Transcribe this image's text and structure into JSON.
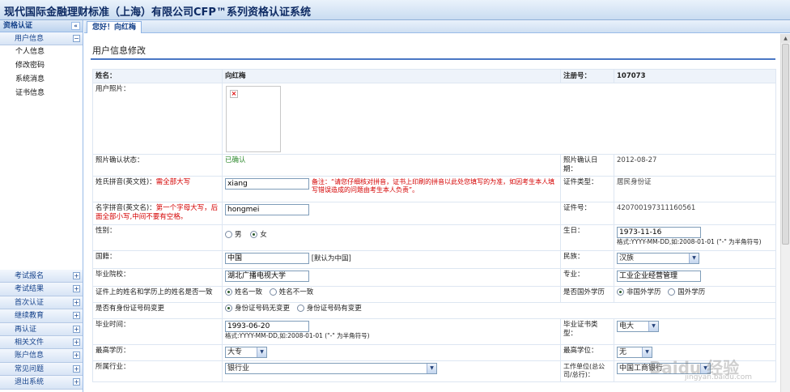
{
  "app": {
    "title": "现代国际金融理财标准（上海）有限公司CFP™系列资格认证系统"
  },
  "sidebar": {
    "title": "资格认证",
    "collapse_icon": "«",
    "expanded_group": {
      "label": "用户信息",
      "toggle": "−",
      "items": [
        {
          "label": "个人信息"
        },
        {
          "label": "修改密码"
        },
        {
          "label": "系统消息"
        },
        {
          "label": "证书信息"
        }
      ]
    },
    "groups": [
      {
        "label": "考试报名",
        "toggle": "+"
      },
      {
        "label": "考试结果",
        "toggle": "+"
      },
      {
        "label": "首次认证",
        "toggle": "+"
      },
      {
        "label": "继续教育",
        "toggle": "+"
      },
      {
        "label": "再认证",
        "toggle": "+"
      },
      {
        "label": "相关文件",
        "toggle": "+"
      },
      {
        "label": "账户信息",
        "toggle": "+"
      },
      {
        "label": "常见问题",
        "toggle": "+"
      },
      {
        "label": "退出系统",
        "toggle": "+"
      }
    ]
  },
  "tab": {
    "label": "您好！向红梅"
  },
  "page": {
    "title": "用户信息修改"
  },
  "form": {
    "name_label": "姓名：",
    "name_value": "向红梅",
    "reg_label": "注册号：",
    "reg_value": "107073",
    "photo_label": "用户照片：",
    "photo_status_label": "照片确认状态：",
    "photo_status_value": "已确认",
    "photo_date_label": "照片确认日期：",
    "photo_date_value": "2012-08-27",
    "surname_label": "姓氏拼音(英文姓)：",
    "surname_hint": "需全部大写",
    "surname_value": "xiang",
    "note_text": "备注：“请您仔细核对拼音，证书上印刷的拼音以此处您填写的为准，如因考生本人填写错误造成的问题由考生本人负责”。",
    "id_type_label": "证件类型：",
    "id_type_value": "居民身份证",
    "given_label": "名字拼音(英文名)：",
    "given_hint": "第一个字母大写，后面全部小写,中间不要有空格。",
    "given_value": "hongmei",
    "id_no_label": "证件号：",
    "id_no_value": "420700197311160561",
    "gender_label": "性别：",
    "gender_male": "男",
    "gender_female": "女",
    "birth_label": "生日：",
    "birth_value": "1973-11-16",
    "date_format": "格式:YYYY-MM-DD,如:2008-01-01 (\"-\" 为半角符号)",
    "nation_label": "国籍：",
    "nation_value": "中国",
    "nation_hint": "[默认为中国]",
    "ethnic_label": "民族：",
    "ethnic_value": "汉族",
    "school_label": "毕业院校：",
    "school_value": "湖北广播电视大学",
    "major_label": "专业：",
    "major_value": "工业企业经营管理",
    "consistent_label": "证件上的姓名和学历上的姓名是否一致",
    "consistent_yes": "姓名一致",
    "consistent_no": "姓名不一致",
    "abroad_label": "是否国外学历",
    "abroad_no": "非国外学历",
    "abroad_yes": "国外学历",
    "idchange_label": "是否有身份证号码变更",
    "idchange_no": "身份证号码无变更",
    "idchange_yes": "身份证号码有变更",
    "grad_label": "毕业时间：",
    "grad_value": "1993-06-20",
    "grad_format": "格式:YYYY-MM-DD,如:2008-01-01 (\"-\" 为半角符号)",
    "certtype_label": "毕业证书类型：",
    "certtype_value": "电大",
    "edu_label": "最高学历：",
    "edu_value": "大专",
    "degree_label": "最高学位：",
    "degree_value": "无",
    "industry_label": "所属行业：",
    "industry_value": "银行业",
    "employer_label": "工作单位(总公司/总行)：",
    "employer_value": "中国工商银行"
  },
  "watermark": {
    "text": "Baidu 经验",
    "sub": "jingyan.baidu.com"
  }
}
